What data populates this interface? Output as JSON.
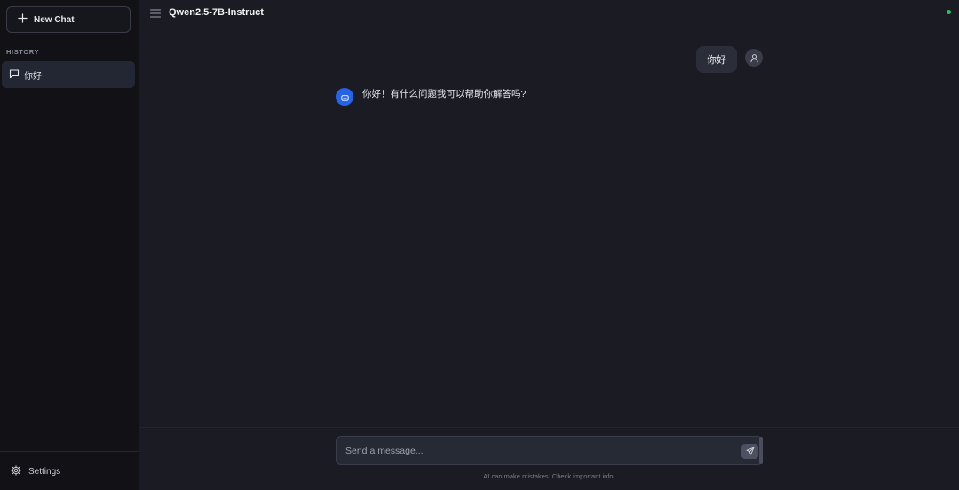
{
  "sidebar": {
    "new_chat_label": "New Chat",
    "history_label": "HISTORY",
    "history_items": [
      {
        "label": "你好"
      }
    ],
    "settings_label": "Settings"
  },
  "header": {
    "model_name": "Qwen2.5-7B-Instruct",
    "status_color": "#22c55e"
  },
  "conversation": {
    "user_message": "你好",
    "assistant_message": "你好！有什么问题我可以帮助你解答吗?"
  },
  "composer": {
    "placeholder": "Send a message...",
    "disclaimer": "AI can make mistakes. Check important info."
  },
  "icons": {
    "new_chat": "plus-icon",
    "history_item": "message-square-icon",
    "settings": "gear-icon",
    "menu": "hamburger-menu-icon",
    "user": "user-icon",
    "assistant": "bot-icon",
    "send": "send-icon"
  },
  "colors": {
    "accent": "#2563eb",
    "sidebar_bg": "#111116",
    "main_bg": "#1a1b23"
  }
}
